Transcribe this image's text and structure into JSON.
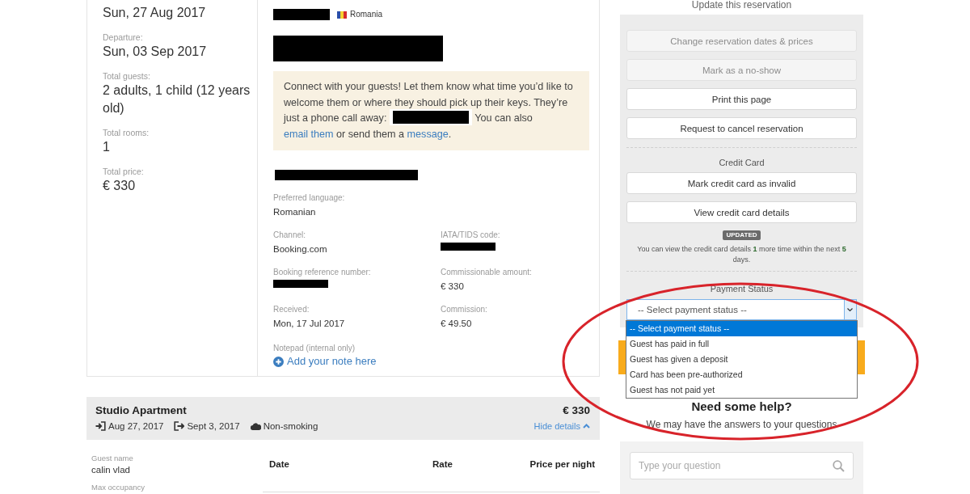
{
  "stay_details": [
    {
      "value": "Sun, 27 Aug 2017"
    },
    {
      "label": "Departure:",
      "value": "Sun, 03 Sep 2017"
    },
    {
      "label": "Total guests:",
      "value": "2 adults, 1 child (12 years old)"
    },
    {
      "label": "Total rooms:",
      "value": "1"
    },
    {
      "label": "Total price:",
      "value": "€ 330"
    }
  ],
  "guest": {
    "name_redacted": true,
    "country": "Romania",
    "contact_redacted": true
  },
  "message": [
    {
      "kind": "text",
      "text": "Connect with your guests! Let them know what time you’d like to welcome them or where they should pick up their keys. They’re just a phone call away: "
    },
    {
      "kind": "redacted"
    },
    {
      "kind": "text",
      "text": " You can also "
    },
    {
      "kind": "link",
      "text": "email them"
    },
    {
      "kind": "text",
      "text": " or send them a "
    },
    {
      "kind": "link",
      "text": "message"
    },
    {
      "kind": "text",
      "text": "."
    }
  ],
  "address_redacted": true,
  "details": [
    [
      {
        "label": "Preferred language:",
        "value": "Romanian"
      }
    ],
    [
      {
        "label": "Channel:",
        "value": "Booking.com"
      },
      {
        "label": "IATA/TIDS code:",
        "redacted": true
      }
    ],
    [
      {
        "label": "Booking reference number:",
        "redacted": true
      },
      {
        "label": "Commissionable amount:",
        "value": "€ 330"
      }
    ],
    [
      {
        "label": "Received:",
        "value": "Mon, 17 Jul 2017"
      },
      {
        "label": "Commission:",
        "value": "€ 49.50"
      }
    ]
  ],
  "notepad": {
    "label": "Notepad (internal only)",
    "link": "Add your note here"
  },
  "actions": {
    "title": "Update this reservation",
    "buttons": [
      {
        "label": "Change reservation dates & prices",
        "disabled": true
      },
      {
        "label": "Mark as a no-show",
        "disabled": true
      },
      {
        "label": "Print this page",
        "disabled": false
      },
      {
        "label": "Request to cancel reservation",
        "disabled": false
      }
    ]
  },
  "credit_card": {
    "title": "Credit Card",
    "buttons": [
      {
        "label": "Mark credit card as invalid",
        "disabled": false
      },
      {
        "label": "View credit card details",
        "disabled": false
      }
    ],
    "badge": "UPDATED",
    "note": "You can view the credit card details **1** more time within the next **5** days."
  },
  "payment_status": {
    "title": "Payment Status",
    "value": "-- Select payment status --",
    "expanded": true,
    "options": [
      {
        "label": "-- Select payment status --",
        "selected": true
      },
      {
        "label": "Guest has paid in full",
        "selected": false
      },
      {
        "label": "Guest has given a deposit",
        "selected": false
      },
      {
        "label": "Card has been pre-authorized",
        "selected": false
      },
      {
        "label": "Guest has not paid yet",
        "selected": false
      }
    ]
  },
  "help": {
    "title": "Need some help?",
    "text": "We may have the answers to your questions",
    "search": {
      "placeholder": "Type your question"
    }
  },
  "room": {
    "name": "Studio Apartment",
    "check_in": "Aug 27, 2017",
    "check_out": "Sept 3, 2017",
    "smoking": "Non-smoking",
    "price": "€ 330",
    "toggle": "Hide details",
    "expanded": true,
    "guest_label": "Guest name",
    "guest_name": "calin vlad",
    "occupancy_label": "Max occupancy",
    "columns": [
      "Date",
      "Rate",
      "Price per night"
    ]
  },
  "annotations": [
    {
      "kind": "ellipse"
    }
  ]
}
